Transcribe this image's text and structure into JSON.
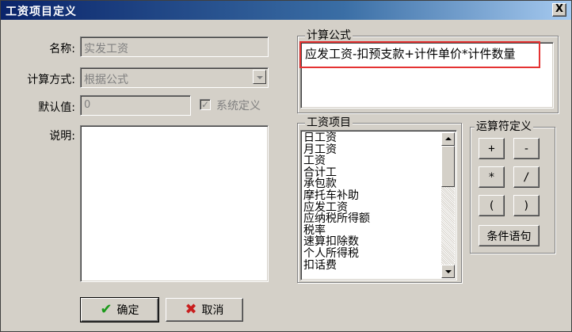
{
  "window": {
    "title": "工资项目定义",
    "close_label": "X"
  },
  "form": {
    "name_label": "名称:",
    "name_value": "实发工资",
    "method_label": "计算方式:",
    "method_value": "根据公式",
    "default_label": "默认值:",
    "default_value": "0",
    "system_defined_label": "系统定义",
    "system_defined_checked": true,
    "description_label": "说明:",
    "description_value": ""
  },
  "formula_group": {
    "title": "计算公式",
    "formula": "应发工资-扣预支款+计件单价*计件数量"
  },
  "items_group": {
    "title": "工资项目",
    "items": [
      "日工资",
      "月工资",
      "工资",
      "合计工",
      "承包款",
      "摩托车补助",
      "应发工资",
      "应纳税所得额",
      "税率",
      "速算扣除数",
      "个人所得税",
      "扣话费"
    ]
  },
  "operators_group": {
    "title": "运算符定义",
    "plus": "+",
    "minus": "-",
    "multiply": "*",
    "divide": "/",
    "lparen": "(",
    "rparen": ")",
    "condition": "条件语句"
  },
  "buttons": {
    "ok": "确定",
    "cancel": "取消"
  },
  "colors": {
    "highlight": "#e53333",
    "title_start": "#0a246a",
    "title_end": "#a6caf0"
  },
  "icons": {
    "ok": "check-icon",
    "cancel": "cross-icon",
    "close": "close-icon"
  }
}
